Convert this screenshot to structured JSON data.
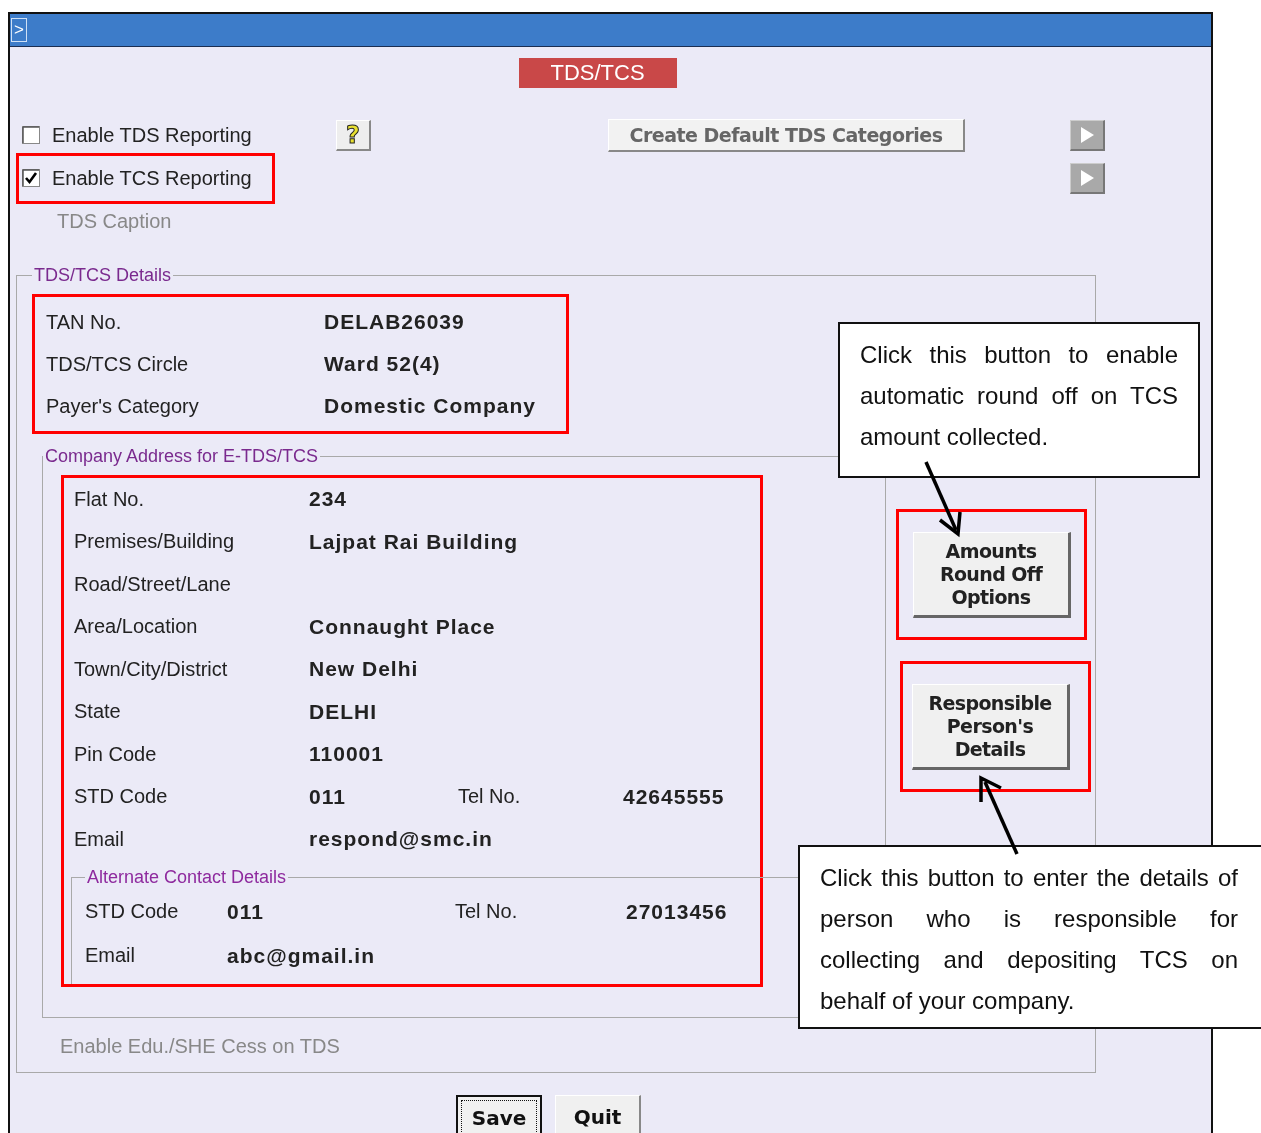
{
  "window": {
    "corner_glyph": ">"
  },
  "title": "TDS/TCS",
  "options": [
    {
      "label": "Enable TDS Reporting",
      "checked": false,
      "highlighted": false
    },
    {
      "label": "Enable TCS Reporting",
      "checked": true,
      "highlighted": true
    }
  ],
  "help_glyph": "?",
  "create_button": "Create Default TDS Categories",
  "tds_caption": "TDS Caption",
  "details": {
    "legend": "TDS/TCS Details",
    "highlighted": true,
    "fields": [
      {
        "label": "TAN No.",
        "value": "DELAB26039"
      },
      {
        "label": "TDS/TCS Circle",
        "value": "Ward 52(4)"
      },
      {
        "label": "Payer's Category",
        "value": "Domestic Company"
      }
    ]
  },
  "address": {
    "legend": "Company Address for E-TDS/TCS",
    "highlighted": true,
    "rows": [
      {
        "label": "Flat No.",
        "value": "234"
      },
      {
        "label": "Premises/Building",
        "value": "Lajpat Rai Building"
      },
      {
        "label": "Road/Street/Lane"
      },
      {
        "label": "Area/Location",
        "value": "Connaught Place"
      },
      {
        "label": "Town/City/District",
        "value": "New Delhi"
      },
      {
        "label": "State",
        "value": "DELHI"
      },
      {
        "label": "Pin Code",
        "value": "110001"
      },
      {
        "label": "STD Code",
        "value": "011",
        "extra_label": "Tel No.",
        "extra_value": "42645555"
      },
      {
        "label": "Email",
        "value": "respond@smc.in"
      }
    ],
    "alternate": {
      "legend": "Alternate Contact Details",
      "rows": [
        {
          "label": "STD Code",
          "value": "011",
          "extra_label": "Tel No.",
          "extra_value": "27013456"
        },
        {
          "label": "Email",
          "value": "abc@gmail.in"
        }
      ]
    }
  },
  "side_buttons": [
    {
      "label": "Amounts Round Off Options",
      "highlighted": true
    },
    {
      "label": "Responsible Person's Details",
      "highlighted": true
    }
  ],
  "cess_label": "Enable Edu./SHE Cess on TDS",
  "buttons": [
    {
      "label": "Save",
      "focused": true
    },
    {
      "label": "Quit",
      "focused": false
    }
  ],
  "callouts": [
    "Click this button to enable automatic round off on TCS amount collected.",
    "Click this button to enter the details of person who is responsible for collecting and depositing TCS on behalf of your company."
  ]
}
